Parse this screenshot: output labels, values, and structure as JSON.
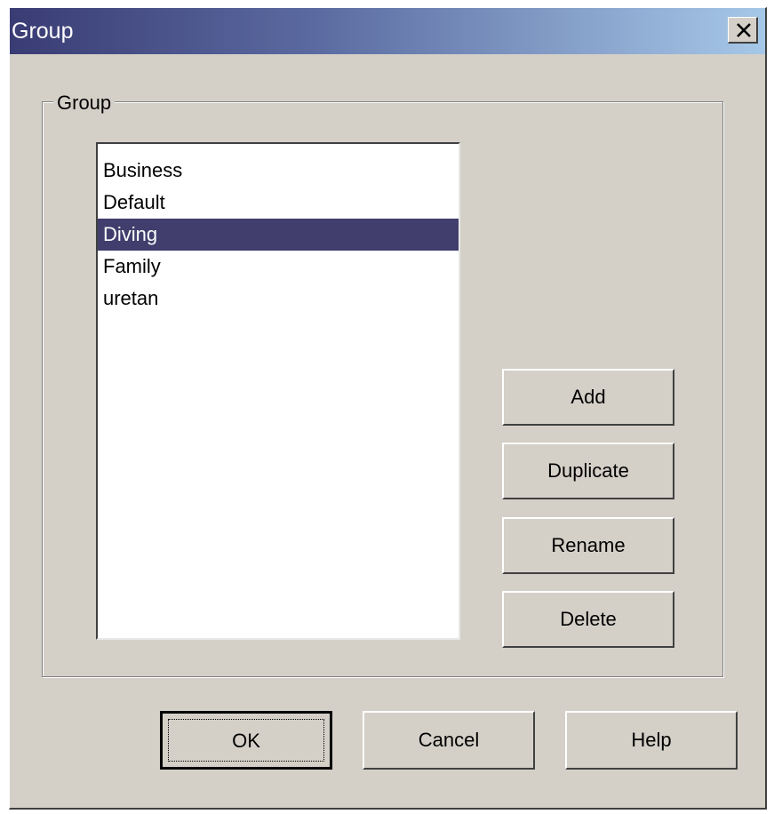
{
  "window": {
    "title": "Group"
  },
  "group_box": {
    "label": "Group"
  },
  "list": {
    "items": [
      "Business",
      "Default",
      "Diving",
      "Family",
      "uretan"
    ],
    "selected": "Diving"
  },
  "side_buttons": {
    "add": "Add",
    "duplicate": "Duplicate",
    "rename": "Rename",
    "delete": "Delete"
  },
  "bottom_buttons": {
    "ok": "OK",
    "cancel": "Cancel",
    "help": "Help"
  },
  "colors": {
    "selection": "#413e6d",
    "face": "#d4d0c8"
  }
}
